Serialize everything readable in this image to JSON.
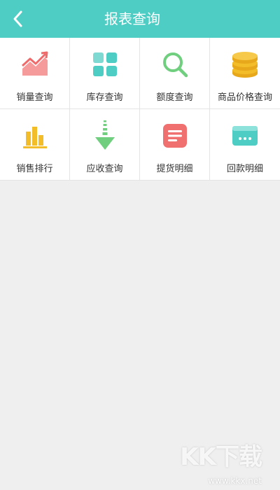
{
  "header": {
    "title": "报表查询",
    "back_icon": "chevron-left-icon",
    "color": "#4ecdc4"
  },
  "grid": {
    "items": [
      {
        "label": "销量查询",
        "icon": "trend-chart-icon",
        "color": "#f07070"
      },
      {
        "label": "库存查询",
        "icon": "blocks-icon",
        "color": "#4ecdc4"
      },
      {
        "label": "额度查询",
        "icon": "search-icon",
        "color": "#6fcf7f"
      },
      {
        "label": "商品价格查询",
        "icon": "coins-stack-icon",
        "color": "#f3bd2a"
      },
      {
        "label": "销售排行",
        "icon": "bar-chart-icon",
        "color": "#f3bd2a"
      },
      {
        "label": "应收查询",
        "icon": "arrow-down-icon",
        "color": "#6fcf7f"
      },
      {
        "label": "提货明细",
        "icon": "document-icon",
        "color": "#f07070"
      },
      {
        "label": "回款明细",
        "icon": "card-icon",
        "color": "#4ecdc4"
      }
    ]
  },
  "watermark": {
    "text": "KK下载",
    "url": "www.kkx.net"
  }
}
